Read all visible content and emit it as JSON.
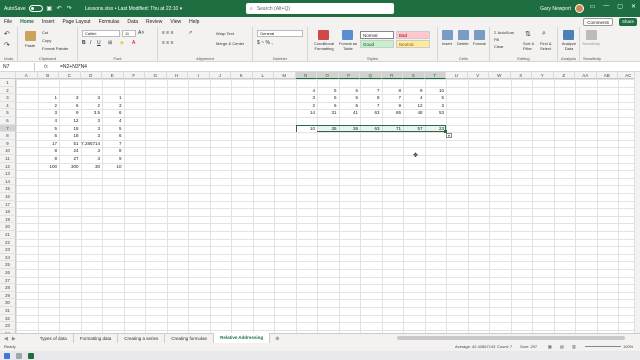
{
  "titlebar": {
    "autosave_label": "AutoSave",
    "autosave_state": "On",
    "filename": "Lessons.xlsx • Last Modified: Thu at 22:10 ▾",
    "search_placeholder": "Search (Alt+Q)",
    "user_name": "Gary Newport"
  },
  "menu": {
    "items": [
      "File",
      "Home",
      "Insert",
      "Page Layout",
      "Formulas",
      "Data",
      "Review",
      "View",
      "Help"
    ],
    "active": "Home",
    "comments_label": "Comments",
    "share_label": "Share"
  },
  "ribbon": {
    "clipboard": {
      "label": "Clipboard",
      "paste": "Paste",
      "cut": "Cut",
      "copy": "Copy",
      "format_painter": "Format Painter",
      "undo_label": "Undo"
    },
    "font": {
      "label": "Font",
      "name": "Calibri",
      "size": "11"
    },
    "alignment": {
      "label": "Alignment",
      "wrap": "Wrap Text",
      "merge": "Merge & Center"
    },
    "number": {
      "label": "Number",
      "format": "General"
    },
    "styles": {
      "label": "Styles",
      "conditional": "Conditional Formatting",
      "format_table": "Format as Table",
      "cell_styles": "Cell Styles",
      "normal": "Normal",
      "bad": "Bad",
      "good": "Good",
      "neutral": "Neutral"
    },
    "cells": {
      "label": "Cells",
      "insert": "Insert",
      "delete": "Delete",
      "format": "Format"
    },
    "editing": {
      "label": "Editing",
      "autosum": "AutoSum",
      "fill": "Fill",
      "clear": "Clear",
      "sort": "Sort & Filter",
      "find": "Find & Select"
    },
    "analysis": {
      "label": "Analysis",
      "analyze": "Analyze Data"
    },
    "sensitivity": {
      "label": "Sensitivity",
      "name": "Sensitivity"
    }
  },
  "formula_bar": {
    "name_box": "N7",
    "fx": "fx",
    "formula": "=N2+N3*N4"
  },
  "columns": [
    "A",
    "B",
    "C",
    "D",
    "E",
    "F",
    "G",
    "H",
    "I",
    "J",
    "K",
    "L",
    "M",
    "N",
    "O",
    "P",
    "Q",
    "R",
    "S",
    "T",
    "U",
    "V",
    "W",
    "X",
    "Y",
    "Z",
    "AA",
    "AB",
    "AC"
  ],
  "rows": [
    "1",
    "2",
    "3",
    "4",
    "5",
    "6",
    "7",
    "8",
    "9",
    "10",
    "11",
    "12",
    "13",
    "14",
    "15",
    "16",
    "17",
    "18",
    "19",
    "20",
    "21",
    "22",
    "23",
    "24",
    "25",
    "26",
    "27",
    "28",
    "29",
    "30",
    "31",
    "32",
    "33",
    "34"
  ],
  "left_table": [
    [
      "1",
      "3",
      "3",
      "1"
    ],
    [
      "2",
      "6",
      "2",
      "3"
    ],
    [
      "3",
      "9",
      "3.5",
      "6"
    ],
    [
      "4",
      "12",
      "3",
      "4"
    ],
    [
      "5",
      "15",
      "3",
      "5"
    ],
    [
      "6",
      "18",
      "3",
      "6"
    ],
    [
      "17",
      "51",
      "7.285714",
      "7"
    ],
    [
      "8",
      "24",
      "3",
      "8"
    ],
    [
      "9",
      "27",
      "3",
      "9"
    ],
    [
      "100",
      "300",
      "30",
      "10"
    ]
  ],
  "right_table": [
    [
      "4",
      "5",
      "6",
      "7",
      "8",
      "9",
      "10"
    ],
    [
      "3",
      "5",
      "6",
      "8",
      "7",
      "4",
      "5"
    ],
    [
      "2",
      "6",
      "5",
      "7",
      "9",
      "12",
      "3"
    ],
    [
      "14",
      "31",
      "41",
      "63",
      "65",
      "48",
      "53"
    ]
  ],
  "result_row": [
    "10",
    "35",
    "36",
    "63",
    "71",
    "57",
    "23"
  ],
  "sheets": [
    "Types of data",
    "Formatting data",
    "Creating a series",
    "Creating formulae",
    "Relative Addressing"
  ],
  "active_sheet": "Relative Addressing",
  "status": {
    "mode": "Ready",
    "average": "Average: 42.42857143",
    "count": "Count: 7",
    "sum": "Sum: 297",
    "zoom": "100%"
  }
}
